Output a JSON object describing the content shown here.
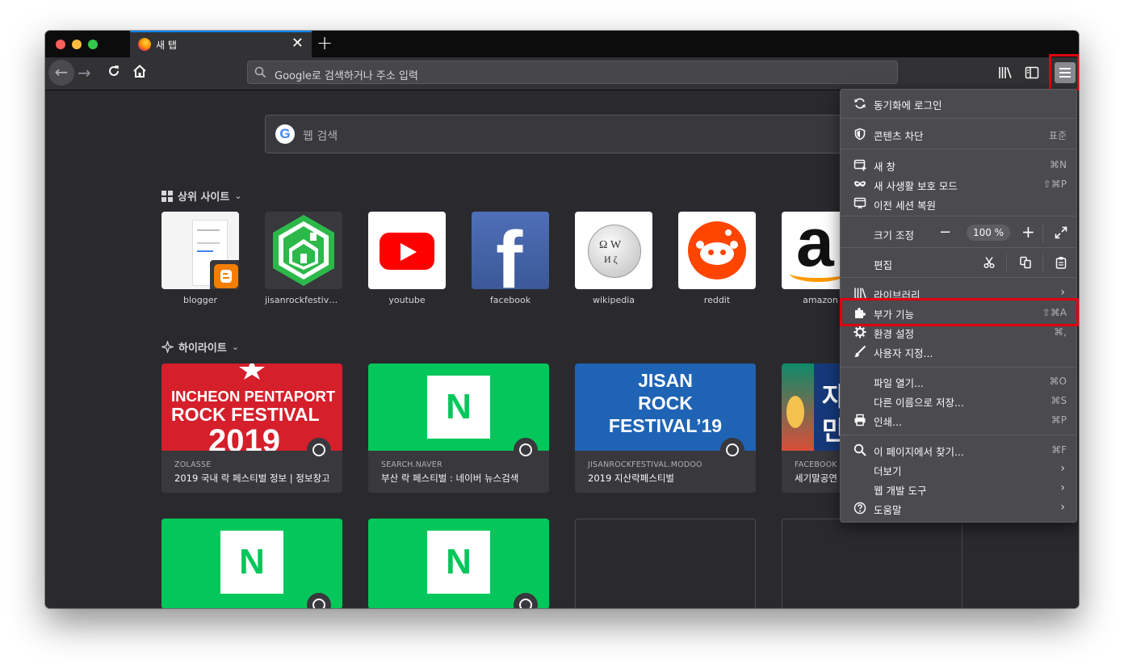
{
  "browser": {
    "tab": {
      "title": "새 탭",
      "close": "✕"
    },
    "new_tab": "+",
    "url_placeholder": "Google로 검색하거나 주소 입력",
    "back": "←",
    "forward": "→"
  },
  "newtab": {
    "search_placeholder": "웹 검색",
    "top_sites_title": "상위 사이트",
    "highlights_title": "하이라이트",
    "top_sites": [
      {
        "label": "blogger",
        "icon": "blogger-icon"
      },
      {
        "label": "jisanrockfestival…",
        "icon": "jisan-house-icon"
      },
      {
        "label": "youtube",
        "icon": "youtube-icon"
      },
      {
        "label": "facebook",
        "icon": "facebook-icon"
      },
      {
        "label": "wikipedia",
        "icon": "wikipedia-icon"
      },
      {
        "label": "reddit",
        "icon": "reddit-icon"
      },
      {
        "label": "amazon",
        "icon": "amazon-icon"
      }
    ],
    "highlights": [
      {
        "source": "ZOLASSE",
        "title": "2019 국내 락 페스티벌 정보 | 정보창고",
        "image_text": [
          "INCHEON PENTAPORT",
          "ROCK FESTIVAL",
          "2019"
        ]
      },
      {
        "source": "SEARCH.NAVER",
        "title": "부산 락 페스티벌 : 네이버 뉴스검색",
        "image_text": [
          "N"
        ]
      },
      {
        "source": "JISANROCKFESTIVAL.MODOO",
        "title": "2019 지산락페스티벌",
        "image_text": [
          "JISAN",
          "ROCK",
          "FESTIVAL’19"
        ]
      },
      {
        "source": "FACEBOOK",
        "title": "세기말공연",
        "image_text": [
          "자",
          "만"
        ]
      }
    ],
    "row2": [
      {
        "image_text": "N"
      },
      {
        "image_text": "N"
      }
    ]
  },
  "app_menu": {
    "sync": "동기화에 로그인",
    "content_blocking": {
      "label": "콘텐츠 차단",
      "value": "표준"
    },
    "new_window": {
      "label": "새 창",
      "shortcut": "⌘N"
    },
    "private_window": {
      "label": "새 사생활 보호 모드",
      "shortcut": "⇧⌘P"
    },
    "restore_session": "이전 세션 복원",
    "zoom": {
      "label": "크기 조정",
      "minus": "−",
      "value": "100 %",
      "plus": "+"
    },
    "edit": "편집",
    "library": "라이브러리",
    "addons": {
      "label": "부가 기능",
      "shortcut": "⇧⌘A"
    },
    "preferences": {
      "label": "환경 설정",
      "shortcut": "⌘,"
    },
    "customize": "사용자 지정...",
    "open_file": {
      "label": "파일 열기...",
      "shortcut": "⌘O"
    },
    "save_as": {
      "label": "다른 이름으로 저장...",
      "shortcut": "⌘S"
    },
    "print": {
      "label": "인쇄...",
      "shortcut": "⌘P"
    },
    "find": {
      "label": "이 페이지에서 찾기...",
      "shortcut": "⌘F"
    },
    "more": "더보기",
    "web_dev": "웹 개발 도구",
    "help": "도움말",
    "arrow": "›"
  },
  "colors": {
    "highlight_box": "#e0000f",
    "accent": "#0a84ff",
    "naver_green": "#03c75a"
  }
}
